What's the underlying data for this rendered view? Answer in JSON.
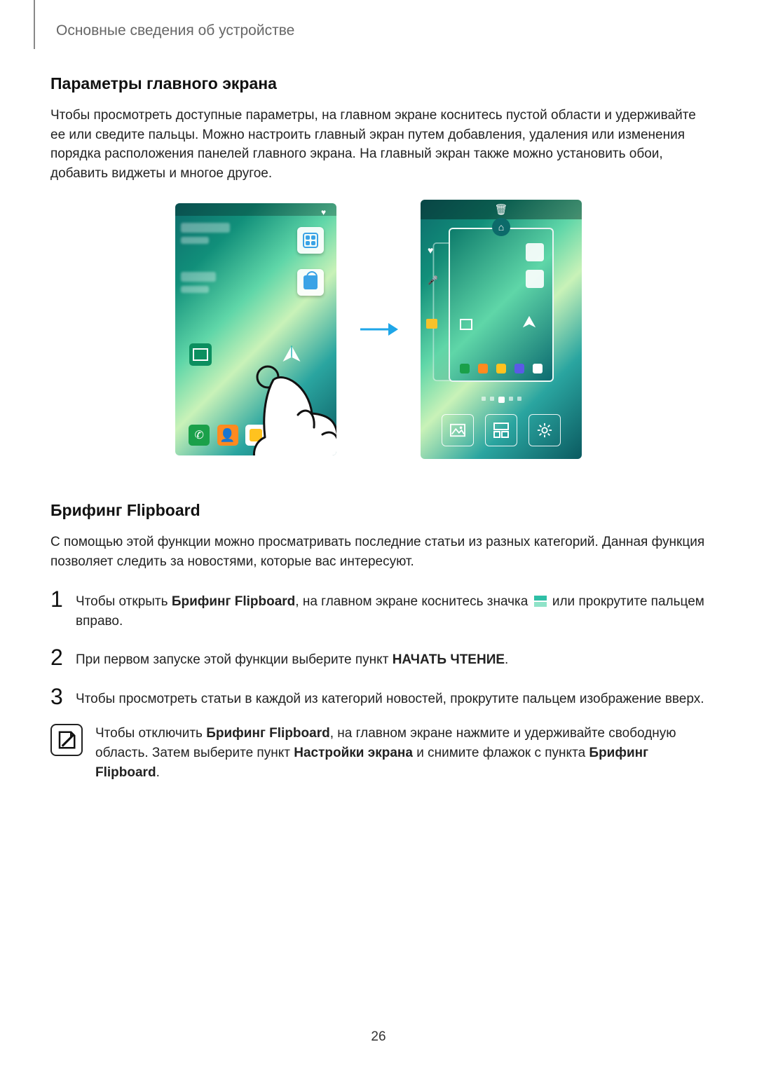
{
  "chapter": "Основные сведения об устройстве",
  "section1": {
    "title": "Параметры главного экрана",
    "para": "Чтобы просмотреть доступные параметры, на главном экране коснитесь пустой области и удерживайте ее или сведите пальцы. Можно настроить главный экран путем добавления, удаления или изменения порядка расположения панелей главного экрана. На главный экран также можно установить обои, добавить виджеты и многое другое."
  },
  "section2": {
    "title": "Брифинг Flipboard",
    "para": "С помощью этой функции можно просматривать последние статьи из разных категорий. Данная функция позволяет следить за новостями, которые вас интересуют.",
    "steps": [
      {
        "pre": "Чтобы открыть ",
        "bold1": "Брифинг Flipboard",
        "mid": ", на главном экране коснитесь значка ",
        "post": " или прокрутите пальцем вправо."
      },
      {
        "pre": "При первом запуске этой функции выберите пункт ",
        "bold1": "НАЧАТЬ ЧТЕНИЕ",
        "post": "."
      },
      {
        "pre": "Чтобы просмотреть статьи в каждой из категорий новостей, прокрутите пальцем изображение вверх."
      }
    ],
    "note": {
      "pre": "Чтобы отключить ",
      "b1": "Брифинг Flipboard",
      "mid1": ", на главном экране нажмите и удерживайте свободную область. Затем выберите пункт ",
      "b2": "Настройки экрана",
      "mid2": " и снимите флажок с пункта ",
      "b3": "Брифинг Flipboard",
      "post": "."
    }
  },
  "pagenum": "26"
}
